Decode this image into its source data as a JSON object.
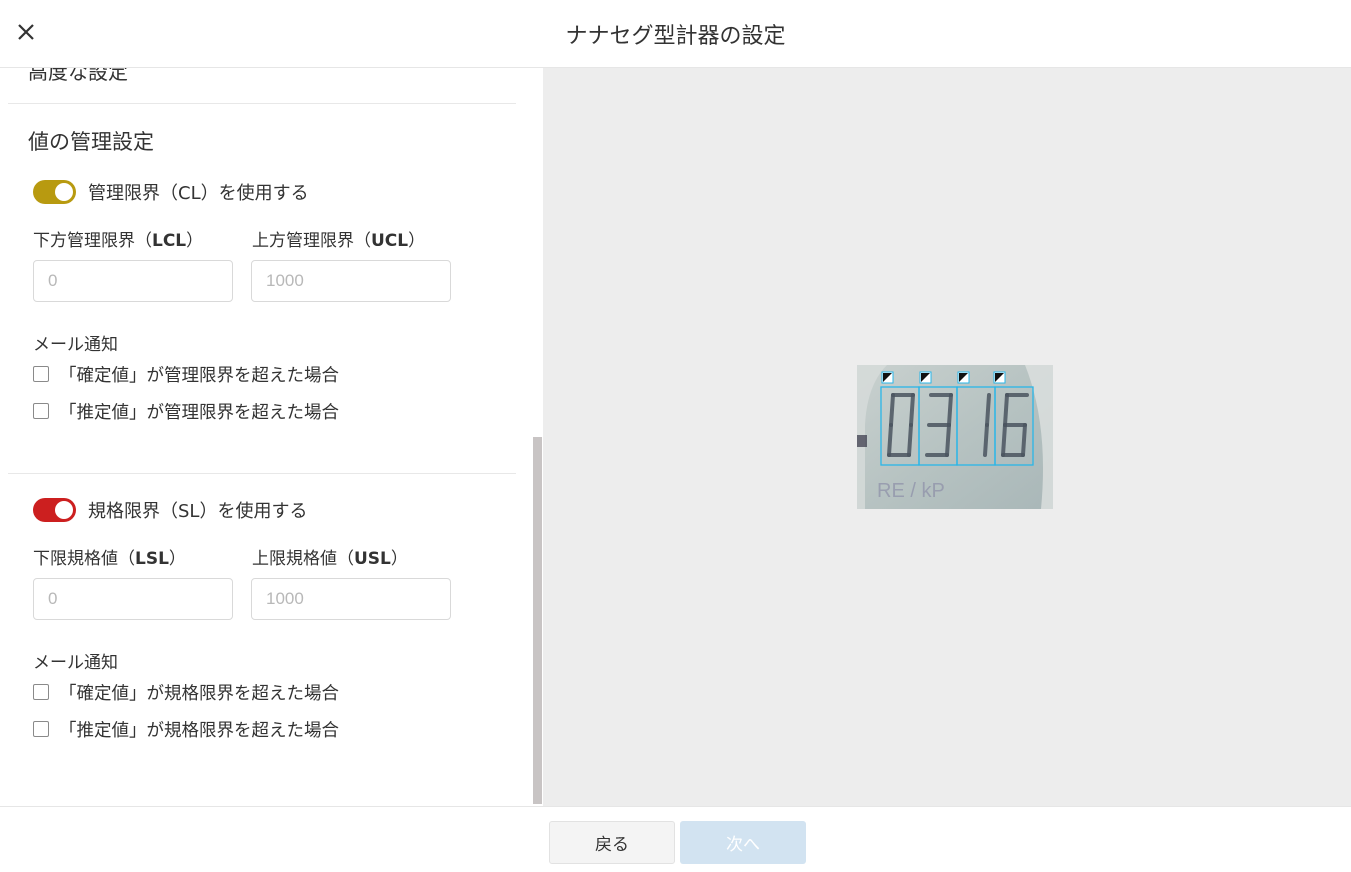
{
  "header": {
    "title": "ナナセグ型計器の設定",
    "close_icon": "close-icon"
  },
  "left": {
    "cut_heading": "高度な設定",
    "section_title": "値の管理設定",
    "control_limit": {
      "toggle_label": "管理限界（CL）を使用する",
      "toggle_on": true,
      "toggle_color": "#b89a10",
      "lcl_label_prefix": "下方管理限界（",
      "lcl_label_code": "LCL",
      "lcl_label_suffix": "）",
      "ucl_label_prefix": "上方管理限界（",
      "ucl_label_code": "UCL",
      "ucl_label_suffix": "）",
      "lcl_placeholder": "0",
      "ucl_placeholder": "1000",
      "mail_label": "メール通知",
      "check1": "「確定値」が管理限界を超えた場合",
      "check2": "「推定値」が管理限界を超えた場合"
    },
    "spec_limit": {
      "toggle_label": "規格限界（SL）を使用する",
      "toggle_on": true,
      "toggle_color": "#cc1f1f",
      "lsl_label_prefix": "下限規格値（",
      "lsl_label_code": "LSL",
      "lsl_label_suffix": "）",
      "usl_label_prefix": "上限規格値（",
      "usl_label_code": "USL",
      "usl_label_suffix": "）",
      "lsl_placeholder": "0",
      "usl_placeholder": "1000",
      "mail_label": "メール通知",
      "check1": "「確定値」が規格限界を超えた場合",
      "check2": "「推定値」が規格限界を超えた場合"
    }
  },
  "preview": {
    "digits": [
      "0",
      "3",
      "1",
      "6"
    ],
    "digit_box_color": "#29b6e8"
  },
  "footer": {
    "back_label": "戻る",
    "next_label": "次へ"
  }
}
